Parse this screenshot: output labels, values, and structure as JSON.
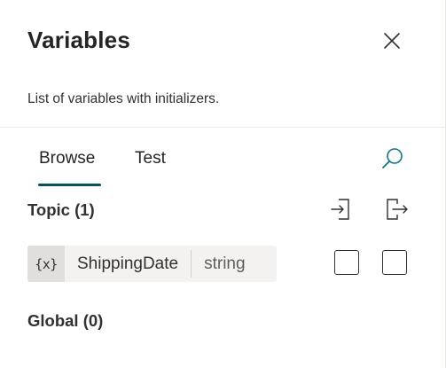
{
  "panel": {
    "title": "Variables",
    "description": "List of variables with initializers."
  },
  "tabs": [
    {
      "label": "Browse",
      "selected": true
    },
    {
      "label": "Test",
      "selected": false
    }
  ],
  "sections": {
    "topic": {
      "heading": "Topic (1)",
      "variables": [
        {
          "icon_text": "{x}",
          "name": "ShippingDate",
          "type": "string"
        }
      ]
    },
    "global": {
      "heading": "Global (0)"
    }
  },
  "icons": {
    "close": "close-icon",
    "search": "search-icon",
    "import": "import-icon",
    "export": "export-icon"
  },
  "colors": {
    "accent": "#0e4f5e",
    "pill_background": "#f3f2f1",
    "text": "#242424"
  }
}
